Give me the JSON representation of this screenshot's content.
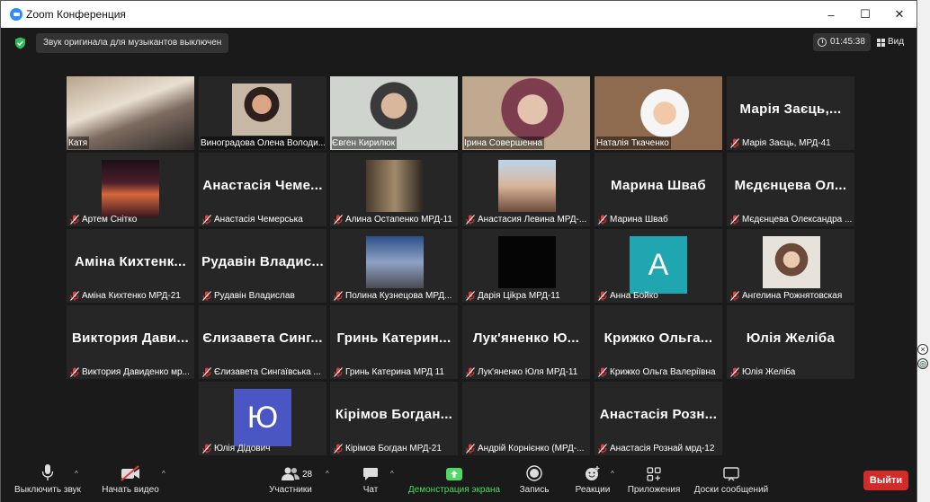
{
  "window": {
    "title": "Zoom Конференция",
    "controls": [
      "–",
      "☐",
      "✕"
    ]
  },
  "infobar": {
    "notice": "Звук оригинала для музыкантов выключен",
    "timer": "01:45:38",
    "view_label": "Вид"
  },
  "participants": [
    {
      "label": "Катя",
      "big": "",
      "muted": false,
      "type": "video"
    },
    {
      "label": "Виноградова Олена Володи...",
      "big": "",
      "muted": false,
      "type": "video"
    },
    {
      "label": "Євген Кирилюк",
      "big": "",
      "muted": false,
      "type": "video",
      "active": true
    },
    {
      "label": "Ірина Совершенна",
      "big": "",
      "muted": false,
      "type": "video"
    },
    {
      "label": "Наталія Ткаченко",
      "big": "",
      "muted": false,
      "type": "video"
    },
    {
      "label": "Марія Заєць, МРД-41",
      "big": "Марія Заєць,...",
      "muted": true,
      "type": "name"
    },
    {
      "label": "Артем Снітко",
      "big": "",
      "muted": true,
      "type": "photo"
    },
    {
      "label": "Анастасія Чемерська",
      "big": "Анастасія Чеме...",
      "muted": true,
      "type": "name"
    },
    {
      "label": "Алина Остапенко МРД-11",
      "big": "",
      "muted": true,
      "type": "photo"
    },
    {
      "label": "Анастасия Левина МРД-...",
      "big": "",
      "muted": true,
      "type": "photo"
    },
    {
      "label": "Марина Шваб",
      "big": "Марина Шваб",
      "muted": true,
      "type": "name"
    },
    {
      "label": "Мєдєнцева Олександра ...",
      "big": "Мєдєнцева Ол...",
      "muted": true,
      "type": "name"
    },
    {
      "label": "Аміна Кихтенко МРД-21",
      "big": "Аміна Кихтенк...",
      "muted": true,
      "type": "name"
    },
    {
      "label": "Рудавін Владислав",
      "big": "Рудавін Владис...",
      "muted": true,
      "type": "name"
    },
    {
      "label": "Полина Кузнецова МРД...",
      "big": "",
      "muted": true,
      "type": "photo"
    },
    {
      "label": "Дарія Ціkра МРД-11",
      "big": "",
      "muted": true,
      "type": "photo"
    },
    {
      "label": "Анна Бойко",
      "big": "",
      "muted": true,
      "type": "avatar",
      "letter": "A"
    },
    {
      "label": "Ангелина Рожнятовская",
      "big": "",
      "muted": true,
      "type": "photo"
    },
    {
      "label": "Виктория Давиденко мр...",
      "big": "Виктория Дави...",
      "muted": true,
      "type": "name"
    },
    {
      "label": "Єлизавета Сингаївська ...",
      "big": "Єлизавета Синг...",
      "muted": true,
      "type": "name"
    },
    {
      "label": "Гринь Катерина МРД 11",
      "big": "Гринь Катерин...",
      "muted": true,
      "type": "name"
    },
    {
      "label": "Лук'яненко Юля МРД-11",
      "big": "Лук'яненко Ю...",
      "muted": true,
      "type": "name"
    },
    {
      "label": "Крижко Ольга Валеріївна",
      "big": "Крижко Ольга...",
      "muted": true,
      "type": "name"
    },
    {
      "label": "Юлія Желіба",
      "big": "Юлія Желіба",
      "muted": true,
      "type": "name"
    },
    {
      "label": "Юлія Дідович",
      "big": "",
      "muted": true,
      "type": "avatar",
      "letter": "Ю"
    },
    {
      "label": "Кірімов Богдан МРД-21",
      "big": "Кірімов Богдан...",
      "muted": true,
      "type": "name"
    },
    {
      "label": "Андрій Корнієнко (МРД-...",
      "big": "",
      "muted": true,
      "type": "blank"
    },
    {
      "label": "Анастасія Рознай мрд-12",
      "big": "Анастасія Розн...",
      "muted": true,
      "type": "name"
    }
  ],
  "toolbar": {
    "mute": "Выключить звук",
    "video": "Начать видео",
    "participants": "Участники",
    "participants_count": "28",
    "chat": "Чат",
    "share": "Демонстрация экрана",
    "record": "Запись",
    "reactions": "Реакции",
    "apps": "Приложения",
    "whiteboards": "Доски сообщений",
    "leave": "Выйти"
  },
  "colors": {
    "accent_green": "#4cd964",
    "leave_red": "#d12c2c",
    "active_speaker": "#a6d96a",
    "avatar_teal": "#1fa6b0",
    "avatar_indigo": "#4a56c4"
  }
}
